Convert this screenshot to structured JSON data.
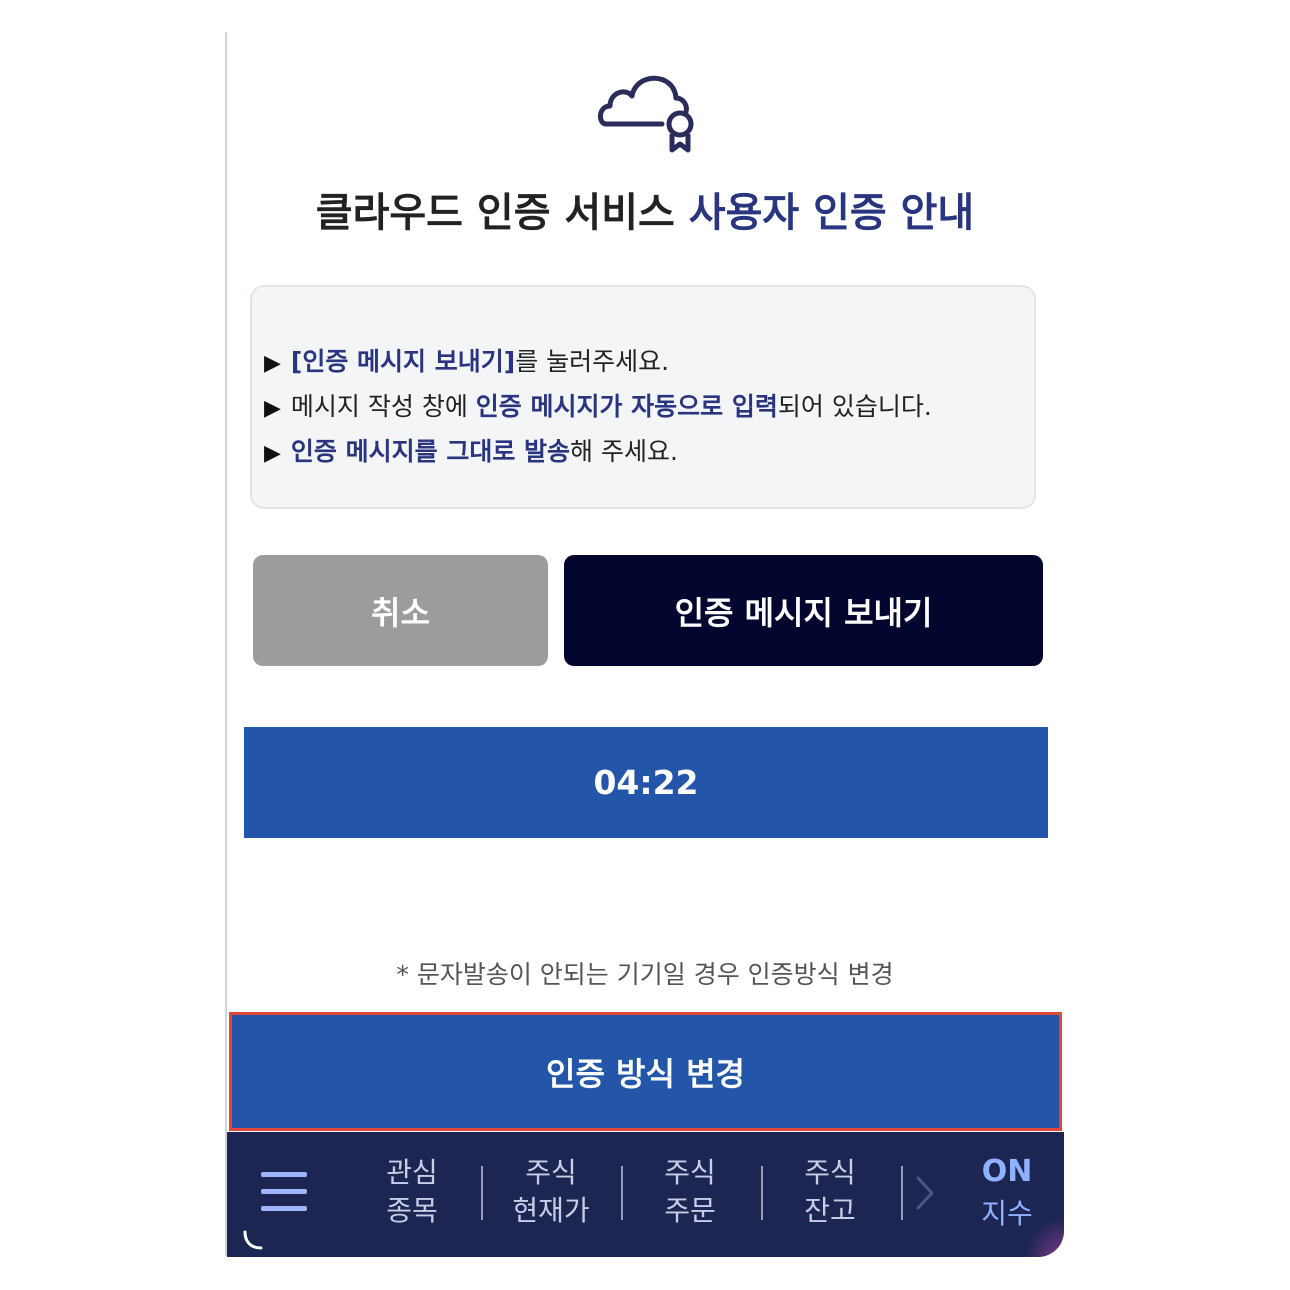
{
  "title": {
    "main": "클라우드 인증 서비스 ",
    "accent": "사용자 인증 안내"
  },
  "instructions": [
    {
      "pre": "",
      "highlight": "[인증 메시지 보내기]",
      "post": "를 눌러주세요."
    },
    {
      "pre": "메시지 작성 창에 ",
      "highlight": "인증 메시지가 자동으로 입력",
      "post": "되어 있습니다."
    },
    {
      "pre": "",
      "highlight": "인증 메시지를 그대로 발송",
      "post": "해 주세요."
    }
  ],
  "arrow_glyph": "▶",
  "buttons": {
    "cancel": "취소",
    "send": "인증 메시지 보내기",
    "change_method": "인증 방식 변경"
  },
  "timer": "04:22",
  "notice": "* 문자발송이 안되는 기기일 경우 인증방식 변경",
  "bottom_nav": {
    "items": [
      {
        "line1": "관심",
        "line2": "종목"
      },
      {
        "line1": "주식",
        "line2": "현재가"
      },
      {
        "line1": "주식",
        "line2": "주문"
      },
      {
        "line1": "주식",
        "line2": "잔고"
      }
    ],
    "on_label": "ON",
    "on_sub": "지수"
  },
  "colors": {
    "accent_text": "#2a3580",
    "send_button": "#02052e",
    "primary_blue": "#2356a8",
    "cancel_button": "#9c9c9c",
    "nav_background": "#1d2552",
    "highlight_border": "#e0463a"
  },
  "icons": {
    "header": "cloud-certificate-icon",
    "menu": "hamburger-menu-icon",
    "more": "chevron-right-icon",
    "loading": "spinner-icon"
  }
}
